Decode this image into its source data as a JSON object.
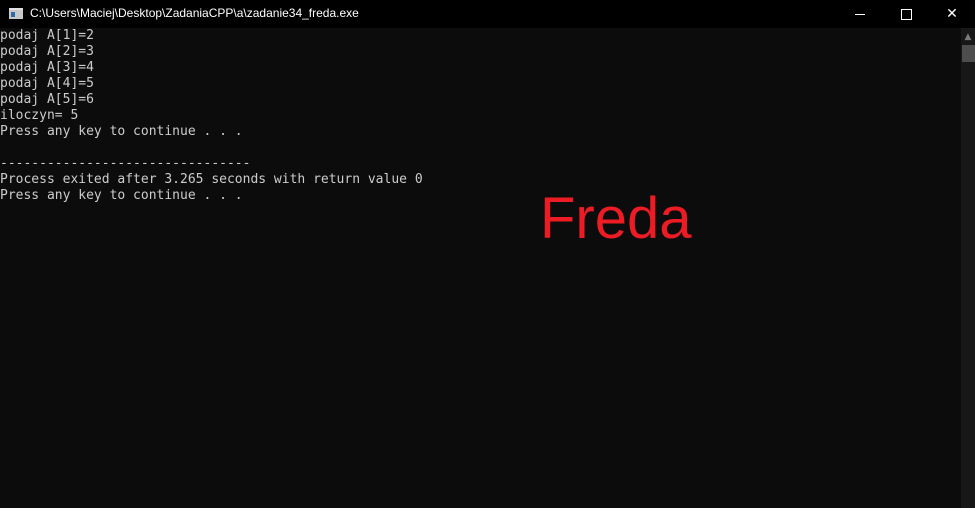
{
  "window": {
    "title": "C:\\Users\\Maciej\\Desktop\\ZadaniaCPP\\a\\zadanie34_freda.exe"
  },
  "console_lines": [
    "podaj A[1]=2",
    "podaj A[2]=3",
    "podaj A[3]=4",
    "podaj A[4]=5",
    "podaj A[5]=6",
    "iloczyn= 5",
    "Press any key to continue . . .",
    "",
    "--------------------------------",
    "Process exited after 3.265 seconds with return value 0",
    "Press any key to continue . . ."
  ],
  "overlay_text": "Freda",
  "colors": {
    "overlay": "#ed1c24",
    "console_bg": "#0c0c0c",
    "console_text": "#cccccc"
  }
}
